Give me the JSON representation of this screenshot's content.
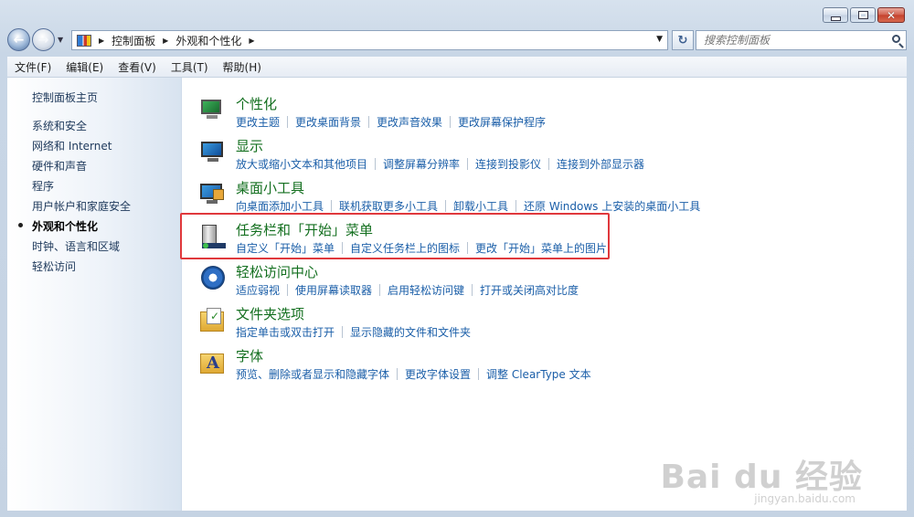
{
  "window": {
    "caption": {
      "minimize": "minimize-icon",
      "maximize": "maximize-icon",
      "close": "close-icon"
    }
  },
  "navbar": {
    "breadcrumb": [
      "控制面板",
      "外观和个性化"
    ],
    "search_placeholder": "搜索控制面板"
  },
  "menu": [
    "文件(F)",
    "编辑(E)",
    "查看(V)",
    "工具(T)",
    "帮助(H)"
  ],
  "sidebar": {
    "home": "控制面板主页",
    "items": [
      {
        "label": "系统和安全"
      },
      {
        "label": "网络和 Internet"
      },
      {
        "label": "硬件和声音"
      },
      {
        "label": "程序"
      },
      {
        "label": "用户帐户和家庭安全"
      },
      {
        "label": "外观和个性化",
        "active": true
      },
      {
        "label": "时钟、语言和区域"
      },
      {
        "label": "轻松访问"
      }
    ]
  },
  "categories": [
    {
      "title": "个性化",
      "icon": "personalization-icon",
      "links": [
        "更改主题",
        "更改桌面背景",
        "更改声音效果",
        "更改屏幕保护程序"
      ]
    },
    {
      "title": "显示",
      "icon": "display-icon",
      "links": [
        "放大或缩小文本和其他项目",
        "调整屏幕分辨率",
        "连接到投影仪",
        "连接到外部显示器"
      ]
    },
    {
      "title": "桌面小工具",
      "icon": "gadgets-icon",
      "links": [
        "向桌面添加小工具",
        "联机获取更多小工具",
        "卸载小工具",
        "还原 Windows 上安装的桌面小工具"
      ]
    },
    {
      "title": "任务栏和「开始」菜单",
      "icon": "taskbar-icon",
      "links": [
        "自定义「开始」菜单",
        "自定义任务栏上的图标",
        "更改「开始」菜单上的图片"
      ]
    },
    {
      "title": "轻松访问中心",
      "icon": "ease-of-access-icon",
      "links": [
        "适应弱视",
        "使用屏幕读取器",
        "启用轻松访问键",
        "打开或关闭高对比度"
      ]
    },
    {
      "title": "文件夹选项",
      "icon": "folder-options-icon",
      "links": [
        "指定单击或双击打开",
        "显示隐藏的文件和文件夹"
      ]
    },
    {
      "title": "字体",
      "icon": "fonts-icon",
      "links": [
        "预览、删除或者显示和隐藏字体",
        "更改字体设置",
        "调整 ClearType 文本"
      ]
    }
  ],
  "watermark": {
    "main": "Bai du 经验",
    "sub": "jingyan.baidu.com"
  }
}
